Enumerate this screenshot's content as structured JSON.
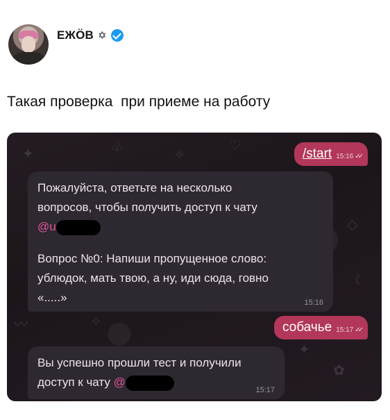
{
  "author": {
    "name": "ЕЖӦВ",
    "star_icon": "pentagram-icon",
    "verified_icon": "verified-badge-icon",
    "verified_color": "#1d9bf0"
  },
  "post": {
    "text": "Такая проверка  при приеме на работу"
  },
  "chat": {
    "messages": [
      {
        "type": "outgoing",
        "text": "/start",
        "time": "15:16"
      },
      {
        "type": "incoming",
        "line1": "Пожалуйста, ответьте на несколько",
        "line2": "вопросов, чтобы получить доступ к чату",
        "mention": "@u",
        "line4": "Вопрос №0: Напиши пропущенное слово:",
        "line5": "ублюдок, мать твою, а ну, иди сюда, говно",
        "line6": "«.....»",
        "time": "15:16"
      },
      {
        "type": "outgoing",
        "text": "собачье",
        "time": "15:17"
      },
      {
        "type": "incoming",
        "line1": "Вы успешно прошли тест и получили",
        "line2": "доступ к чату",
        "mention": "@",
        "time": "15:17"
      }
    ],
    "accent": "#b2375a",
    "incoming_bg": "#2e2830"
  }
}
